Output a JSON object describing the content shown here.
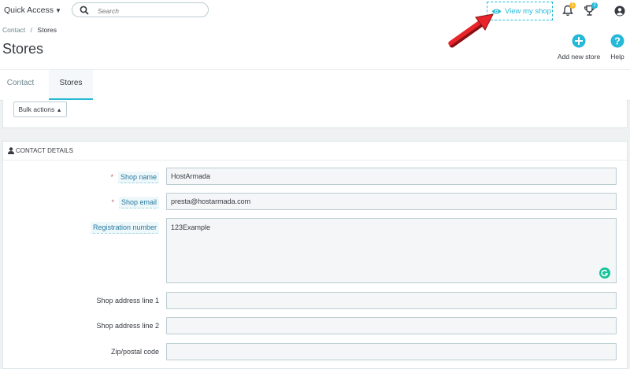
{
  "topbar": {
    "quick_access_label": "Quick Access",
    "search_placeholder": "Search",
    "view_shop_label": "View my shop",
    "notifications_count": "1",
    "trophy_count": "2"
  },
  "breadcrumb": {
    "parent": "Contact",
    "separator": "/",
    "current": "Stores"
  },
  "page_title": "Stores",
  "toolbar": {
    "add_label": "Add new store",
    "help_label": "Help"
  },
  "tabs": [
    {
      "label": "Contact"
    },
    {
      "label": "Stores"
    }
  ],
  "bulk_actions_label": "Bulk actions",
  "contact_panel": {
    "title": "CONTACT DETAILS",
    "required_mark": "*",
    "fields": {
      "shop_name": {
        "label": "Shop name",
        "value": "HostArmada"
      },
      "shop_email": {
        "label": "Shop email",
        "value": "presta@hostarmada.com"
      },
      "registration_number": {
        "label": "Registration number",
        "value": "123Example"
      },
      "address1": {
        "label": "Shop address line 1",
        "value": ""
      },
      "address2": {
        "label": "Shop address line 2",
        "value": ""
      },
      "zip": {
        "label": "Zip/postal code",
        "value": ""
      }
    }
  },
  "colors": {
    "accent": "#25b9d7",
    "required": "#c05c67",
    "annotation_arrow": "#e8242a",
    "badge": "#fbbb22"
  }
}
